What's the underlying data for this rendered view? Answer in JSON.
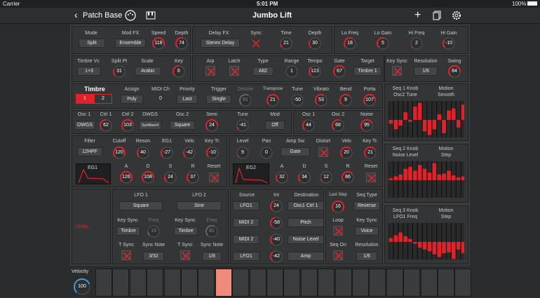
{
  "status": {
    "carrier": "Carrier",
    "time": "5:01 PM",
    "battery": "100%"
  },
  "nav": {
    "back": "Patch Base",
    "title": "Jumbo Lift"
  },
  "colors": {
    "accent": "#e0232b",
    "bg": "#3a3c3e",
    "panel": "#333537"
  },
  "row1": {
    "mode_l": "Mode",
    "mode_v": "Split",
    "modfx_l": "Mod FX",
    "modfx_v": "Ensemble",
    "speed_l": "Speed",
    "speed_v": "118",
    "depth_l": "Depth",
    "depth_v": "74",
    "dfx_l": "Delay FX",
    "dfx_v": "Stereo Delay",
    "sync_l": "Sync",
    "time_l": "Time",
    "time_v": "21",
    "ddepth_l": "Depth",
    "ddepth_v": "30",
    "lofreq_l": "Lo Freq",
    "lofreq_v": "18",
    "logain_l": "Lo Gain",
    "logain_v": "5",
    "hifreq_l": "Hi Freq",
    "hifreq_v": "2",
    "higain_l": "Hi Gain",
    "higain_v": "-10"
  },
  "row2": {
    "tvc_l": "Timbre Vc",
    "tvc_v": "1+3",
    "split_l": "Split Pt",
    "split_v": "31",
    "scale_l": "Scale",
    "scale_v": "Arabic",
    "key_l": "Key",
    "key_v": "6",
    "arp_l": "Arp",
    "latch_l": "Latch",
    "type_l": "Type",
    "type_v": "Alt2",
    "range_l": "Range",
    "range_v": "1",
    "tempo_l": "Tempo",
    "tempo_v": "123",
    "gate_l": "Gate",
    "gate_v": "67",
    "target_l": "Target",
    "target_v": "Timbre 1",
    "keysync_l": "Key Sync",
    "res_l": "Resolution",
    "res_v": "1/6",
    "swing_l": "Swing",
    "swing_v": "84"
  },
  "timbre": {
    "title": "Timbre",
    "t1": "1",
    "t2": "2",
    "assign_l": "Assign",
    "assign_v": "Poly",
    "midich_l": "MIDI Ch",
    "midich_v": "0",
    "prio_l": "Priority",
    "prio_v": "Last",
    "trig_l": "Trigger",
    "trig_v": "Single",
    "detune_l": "Detune",
    "detune_v": "81",
    "transp_l": "Transpose",
    "transp_v": "21",
    "tune_l": "Tune",
    "tune_v": "-50",
    "vib_l": "Vibrato",
    "vib_v": "53",
    "bend_l": "Bend",
    "bend_v": "9",
    "porta_l": "Porta",
    "porta_v": "107"
  },
  "osc": {
    "o1_l": "Osc 1",
    "o1_v": "DWGS",
    "c1_l": "Ctrl 1",
    "c1_v": "62",
    "c2_l": "Ctrl 2",
    "c2_v": "103",
    "dwgs_l": "DWGS",
    "dwgs_v": "SynWave4",
    "o2_l": "Osc 2",
    "o2_v": "Square",
    "semi_l": "Semi",
    "semi_v": "24",
    "tune_l": "Tune",
    "tune_v": "-41",
    "mod_l": "Mod",
    "mod_v": "Off",
    "m1_l": "Osc 1",
    "m1_v": "44",
    "m2_l": "Osc 2",
    "m2_v": "68",
    "noise_l": "Noise",
    "noise_v": "95"
  },
  "filter": {
    "filter_l": "Filter",
    "filter_v": "12HPF",
    "cutoff_l": "Cutoff",
    "cutoff_v": "120",
    "reson_l": "Reson",
    "reson_v": "40",
    "eg1_l": "EG1",
    "eg1_v": "-27",
    "velo_l": "Velo",
    "velo_v": "-42",
    "keytr_l": "Key Tr.",
    "keytr_v": "-10",
    "eg_name": "EG1",
    "a_l": "A",
    "a_v": "126",
    "d_l": "D",
    "d_v": "108",
    "s_l": "S",
    "s_v": "24",
    "r_l": "R",
    "r_v": "37",
    "reset_l": "Reset"
  },
  "amp": {
    "level_l": "Level",
    "level_v": "9",
    "pan_l": "Pan",
    "pan_v": "0",
    "ampsw_l": "Amp Sw",
    "ampsw_v": "Gate",
    "dist_l": "Distort",
    "velo_l": "Velo",
    "velo_v": "20",
    "keytr_l": "Key Tr.",
    "keytr_v": "21",
    "eg_name": "EG2",
    "a_l": "A",
    "a_v": "32",
    "d_l": "D",
    "d_v": "34",
    "s_l": "S",
    "s_v": "12",
    "r_l": "R",
    "r_v": "86",
    "reset_l": "Reset"
  },
  "lfo": {
    "utility": "Utility...",
    "l1_l": "LFO 1",
    "l1_v": "Square",
    "l2_l": "LFO 2",
    "l2_v": "Sine",
    "ks1_l": "Key Sync",
    "ks1_v": "Timbre",
    "f1_l": "Freq",
    "f1_v": "19",
    "ks2_l": "Key Sync",
    "ks2_v": "Timbre",
    "f2_l": "Freq",
    "f2_v": "81",
    "ts1_l": "T Sync",
    "sn1_l": "Sync Note",
    "sn1_v": "3/32",
    "ts2_l": "T Sync",
    "sn2_l": "Sync Note",
    "sn2_v": "1/8"
  },
  "patch": {
    "src_l": "Source",
    "int_l": "Int",
    "dest_l": "Destination",
    "srcs": [
      "LFO1",
      "MIDI 2",
      "MIDI 2",
      "LFO1"
    ],
    "ints": [
      "24",
      "-58",
      "-40",
      "-42"
    ],
    "dests": [
      "Osc1 Ctrl 1",
      "Pitch",
      "Noise Level",
      "Amp"
    ]
  },
  "seq": {
    "last_l": "Last Step",
    "last_v": "16",
    "stype_l": "Seq Type",
    "stype_v": "Reverse",
    "loop_l": "Loop",
    "ks_l": "Key Sync",
    "ks_v": "Voice",
    "son_l": "Seq On",
    "res_l": "Resolution",
    "res_v": "1/6"
  },
  "seqs": [
    {
      "knob_l": "Seq 1 Knob",
      "knob_v": "Osc2 Tune",
      "motion_l": "Motion",
      "motion_v": "Smooth",
      "vals": [
        -0.2,
        -0.5,
        -0.3,
        0.4,
        -0.1,
        0.7,
        0.9,
        -0.6,
        -0.8,
        -0.5,
        0.3,
        -0.7,
        0.5,
        0.6,
        -0.4,
        0.8
      ]
    },
    {
      "knob_l": "Seq 2 Knob",
      "knob_v": "Noise Level",
      "motion_l": "Motion",
      "motion_v": "Step",
      "vals": [
        0.1,
        0.2,
        0.3,
        0.6,
        0.7,
        0.5,
        0.8,
        0.6,
        0.4,
        0.9,
        0.3,
        0.35,
        0.5,
        0.25,
        0.15,
        0.2
      ]
    },
    {
      "knob_l": "Seq 3 Knob",
      "knob_v": "LFO1 Freq",
      "motion_l": "Motion",
      "motion_v": "Step",
      "vals": [
        0.2,
        0.35,
        0.5,
        0.3,
        0.15,
        -0.1,
        -0.3,
        -0.4,
        -0.5,
        -0.65,
        -0.8,
        -0.6,
        -0.55,
        -0.9,
        -0.4,
        -0.6
      ]
    }
  ],
  "velocity": {
    "label": "Velocity",
    "value": "100"
  }
}
